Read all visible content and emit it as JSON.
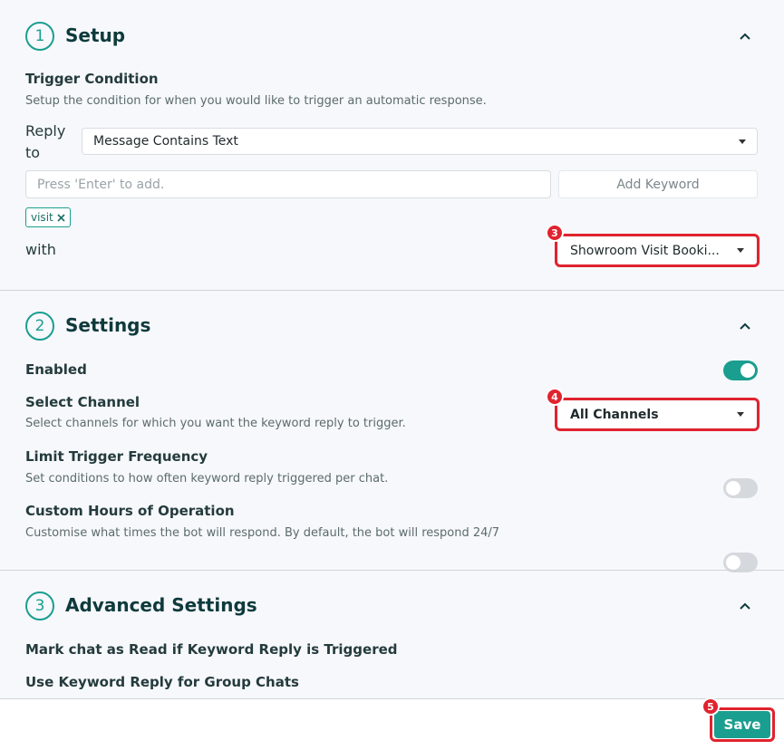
{
  "setup": {
    "step": "1",
    "title": "Setup",
    "trigger_label": "Trigger Condition",
    "trigger_desc": "Setup the condition for when you would like to trigger an automatic response.",
    "reply_to_label_1": "Reply",
    "reply_to_label_2": "to",
    "reply_select_value": "Message Contains Text",
    "keyword_placeholder": "Press 'Enter' to add.",
    "add_keyword_label": "Add Keyword",
    "chip_label": "visit",
    "with_label": "with",
    "with_select_value": "Showroom Visit Booki...",
    "badge": "3"
  },
  "settings": {
    "step": "2",
    "title": "Settings",
    "enabled_label": "Enabled",
    "channel_label": "Select Channel",
    "channel_desc": "Select channels for which you want the keyword reply to trigger.",
    "channel_value": "All Channels",
    "channel_badge": "4",
    "limit_label": "Limit Trigger Frequency",
    "limit_desc": "Set conditions to how often keyword reply triggered per chat.",
    "hours_label": "Custom Hours of Operation",
    "hours_desc": "Customise what times the bot will respond. By default, the bot will respond 24/7"
  },
  "advanced": {
    "step": "3",
    "title": "Advanced Settings",
    "mark_read_label": "Mark chat as Read if Keyword Reply is Triggered",
    "group_label": "Use Keyword Reply for Group Chats"
  },
  "footer": {
    "save_label": "Save",
    "save_badge": "5"
  },
  "colors": {
    "accent": "#1a9e8f",
    "highlight": "#e0232e"
  }
}
